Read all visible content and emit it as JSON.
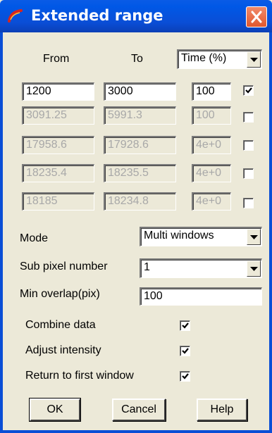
{
  "window": {
    "title": "Extended range",
    "close_icon": "close-icon"
  },
  "colors": {
    "titlebar": "#0a4ed6",
    "close": "#e2582e",
    "face": "#ece9d8"
  },
  "header": {
    "from_label": "From",
    "to_label": "To",
    "unit_select": "Time (%)"
  },
  "ranges": [
    {
      "from": "1200",
      "to": "3000",
      "value": "100",
      "checked": true,
      "enabled": true
    },
    {
      "from": "3091.25",
      "to": "5991.3",
      "value": "100",
      "checked": false,
      "enabled": false
    },
    {
      "from": "17958.6",
      "to": "17928.6",
      "value": "4e+0",
      "checked": false,
      "enabled": false
    },
    {
      "from": "18235.4",
      "to": "18235.5",
      "value": "4e+0",
      "checked": false,
      "enabled": false
    },
    {
      "from": "18185",
      "to": "18234.8",
      "value": "4e+0",
      "checked": false,
      "enabled": false
    }
  ],
  "mode": {
    "label": "Mode",
    "value": "Multi windows"
  },
  "sub_pixel": {
    "label": "Sub pixel number",
    "value": "1"
  },
  "min_overlap": {
    "label": "Min overlap(pix)",
    "value": "100"
  },
  "options": [
    {
      "label": "Combine data",
      "checked": true
    },
    {
      "label": "Adjust intensity",
      "checked": true
    },
    {
      "label": "Return to first window",
      "checked": true
    }
  ],
  "buttons": {
    "ok": "OK",
    "cancel": "Cancel",
    "help": "Help"
  }
}
